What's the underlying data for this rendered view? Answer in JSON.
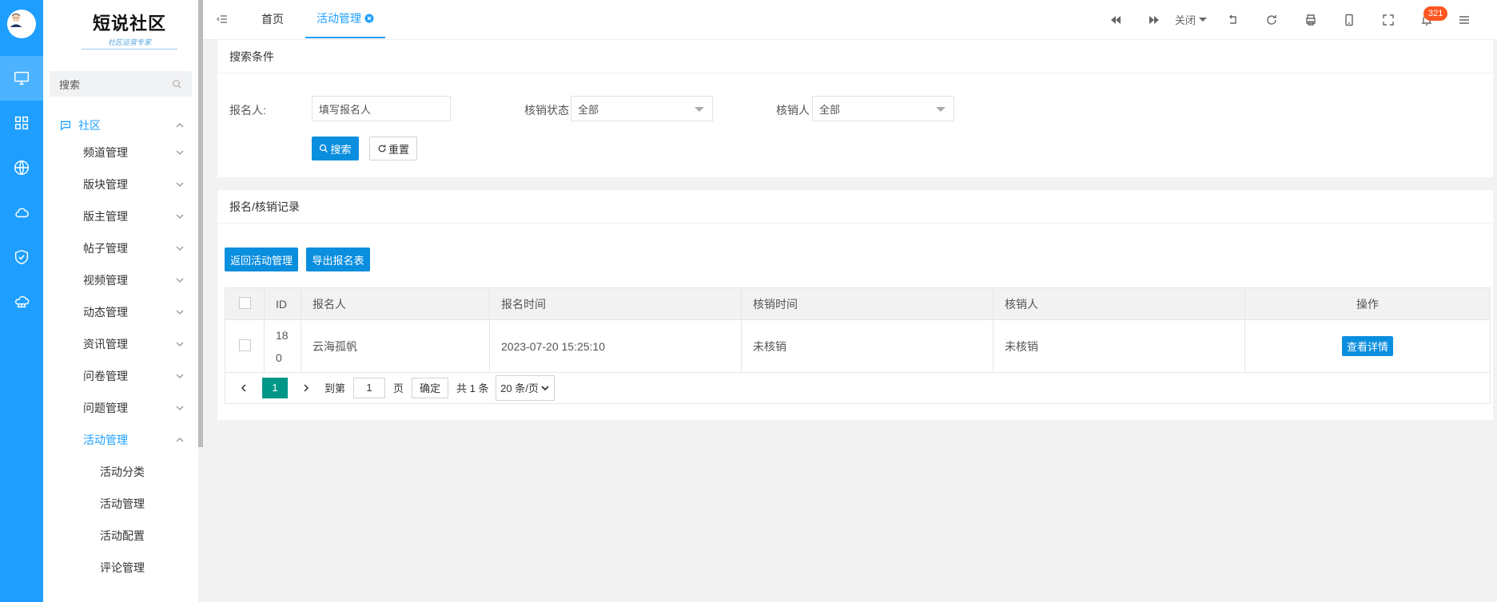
{
  "rail": {
    "items": [
      "monitor-icon",
      "grid-icon",
      "globe-icon",
      "cloud-icon",
      "shield-icon",
      "cloud-network-icon"
    ]
  },
  "sidebar": {
    "logo_title": "短说社区",
    "logo_subtitle": "社区运营专家",
    "search_placeholder": "搜索",
    "group_label": "社区",
    "items": [
      {
        "label": "频道管理"
      },
      {
        "label": "版块管理"
      },
      {
        "label": "版主管理"
      },
      {
        "label": "帖子管理"
      },
      {
        "label": "视频管理"
      },
      {
        "label": "动态管理"
      },
      {
        "label": "资讯管理"
      },
      {
        "label": "问卷管理"
      },
      {
        "label": "问题管理"
      },
      {
        "label": "活动管理"
      }
    ],
    "sub_items": [
      {
        "label": "活动分类"
      },
      {
        "label": "活动管理"
      },
      {
        "label": "活动配置"
      },
      {
        "label": "评论管理"
      }
    ]
  },
  "topbar": {
    "tabs": [
      {
        "label": "首页"
      },
      {
        "label": "活动管理"
      }
    ],
    "close_label": "关闭",
    "notification_count": "321"
  },
  "search_card": {
    "title": "搜索条件",
    "fields": {
      "registrant_label": "报名人:",
      "registrant_placeholder": "填写报名人",
      "status_label": "核销状态",
      "status_value": "全部",
      "verifier_label": "核销人",
      "verifier_value": "全部"
    },
    "search_button": "搜索",
    "reset_button": "重置"
  },
  "records_card": {
    "title": "报名/核销记录",
    "back_button": "返回活动管理",
    "export_button": "导出报名表",
    "columns": [
      "ID",
      "报名人",
      "报名时间",
      "核销时间",
      "核销人",
      "操作"
    ],
    "rows": [
      {
        "id_line1": "18",
        "id_line2": "0",
        "registrant": "云海孤帆",
        "register_time": "2023-07-20 15:25:10",
        "verify_time": "未核销",
        "verifier": "未核销",
        "action": "查看详情"
      }
    ],
    "pager": {
      "current_page": "1",
      "goto_label": "到第",
      "goto_value": "1",
      "page_unit": "页",
      "confirm_label": "确定",
      "total_label": "共 1 条",
      "page_size": "20 条/页"
    }
  }
}
